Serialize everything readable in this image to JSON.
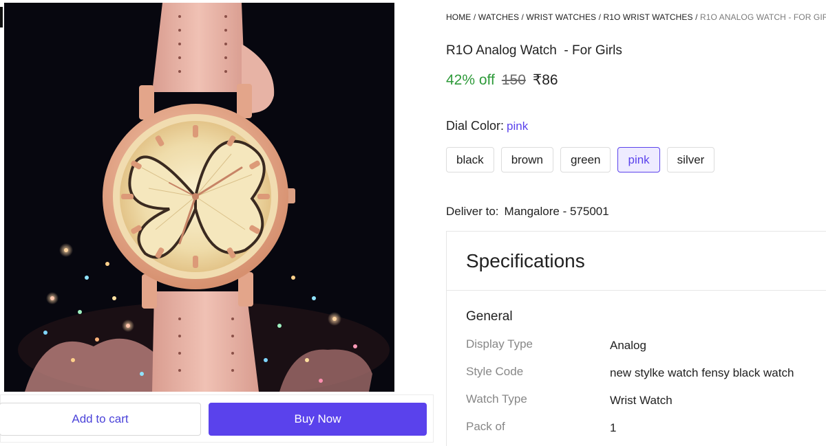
{
  "breadcrumb": [
    {
      "label": "HOME"
    },
    {
      "label": "WATCHES"
    },
    {
      "label": "WRIST WATCHES"
    },
    {
      "label": "R1O WRIST WATCHES"
    },
    {
      "label": "R1O ANALOG WATCH - FOR GIRLS"
    }
  ],
  "product": {
    "title": "R1O Analog Watch  - For Girls",
    "discount": "42% off",
    "mrp": "150",
    "price": "₹86",
    "image_alt": "Rose gold analog watch with pink leather strap"
  },
  "variant": {
    "label": "Dial Color:",
    "selected": "pink",
    "options": [
      "black",
      "brown",
      "green",
      "pink",
      "silver"
    ]
  },
  "delivery": {
    "label": "Deliver to:",
    "location": "Mangalore - 575001"
  },
  "specifications": {
    "title": "Specifications",
    "group": "General",
    "rows": [
      {
        "key": "Display Type",
        "value": "Analog"
      },
      {
        "key": "Style Code",
        "value": "new stylke watch fensy black watch"
      },
      {
        "key": "Watch Type",
        "value": "Wrist Watch"
      },
      {
        "key": "Pack of",
        "value": "1"
      }
    ]
  },
  "actions": {
    "add_to_cart": "Add to cart",
    "buy_now": "Buy Now"
  },
  "colors": {
    "accent": "#5a42ec",
    "discount_green": "#2e9a3a",
    "strap_pink": "#e8b5a8",
    "case_rose_gold": "#e6a98e"
  }
}
